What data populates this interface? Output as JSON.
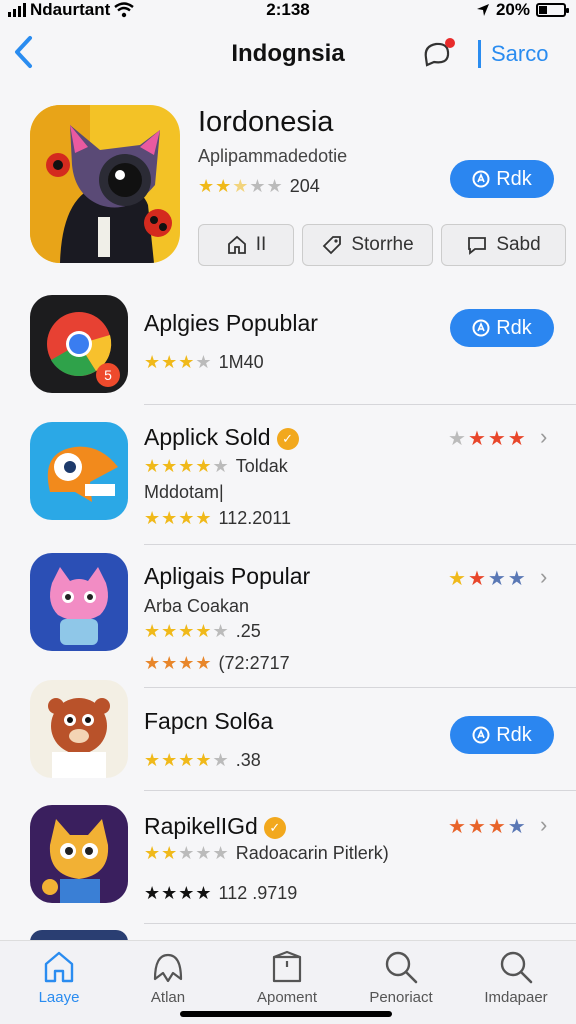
{
  "status_bar": {
    "carrier": "Ndaurtant",
    "time": "2:138",
    "battery": "20%"
  },
  "nav": {
    "back_label": "‹",
    "title": "Indognsia",
    "right_link": "Sarco"
  },
  "featured": {
    "name": "Iordonesia",
    "subtitle": "Aplipammadedotie",
    "rating_text": "204",
    "rating": 2.5,
    "get_label": "Rdk",
    "chips": [
      "II",
      "Storrhe",
      "Sabd"
    ]
  },
  "apps": [
    {
      "name": "Aplgies Popublar",
      "line1": "1M40",
      "rating": 3,
      "get_label": "Rdk"
    },
    {
      "name": "Applick Sold",
      "line1": "Toldak",
      "line2": "Mddotam|",
      "line3": "112.2011",
      "right_stars": 4
    },
    {
      "name": "Apligais Popular",
      "line1": "Arba Coakan",
      "line2": ".25",
      "line3": "(72:2717",
      "right_stars": 4
    },
    {
      "name": "Fapcn Sol6a",
      "line1": ".38",
      "get_label": "Rdk"
    },
    {
      "name": "RapikelIGd",
      "line1": "Radoacarin Pitlerk)",
      "line2": "112 .9719",
      "right_stars": 4
    }
  ],
  "tabs": [
    "Laaye",
    "Atlan",
    "Apoment",
    "Penoriact",
    "Imdapaer"
  ],
  "colors": {
    "accent": "#2a8cf0",
    "button": "#2b86f0",
    "star": "#f0b91a",
    "star_red": "#e8462a",
    "badge": "#e82b2b"
  }
}
